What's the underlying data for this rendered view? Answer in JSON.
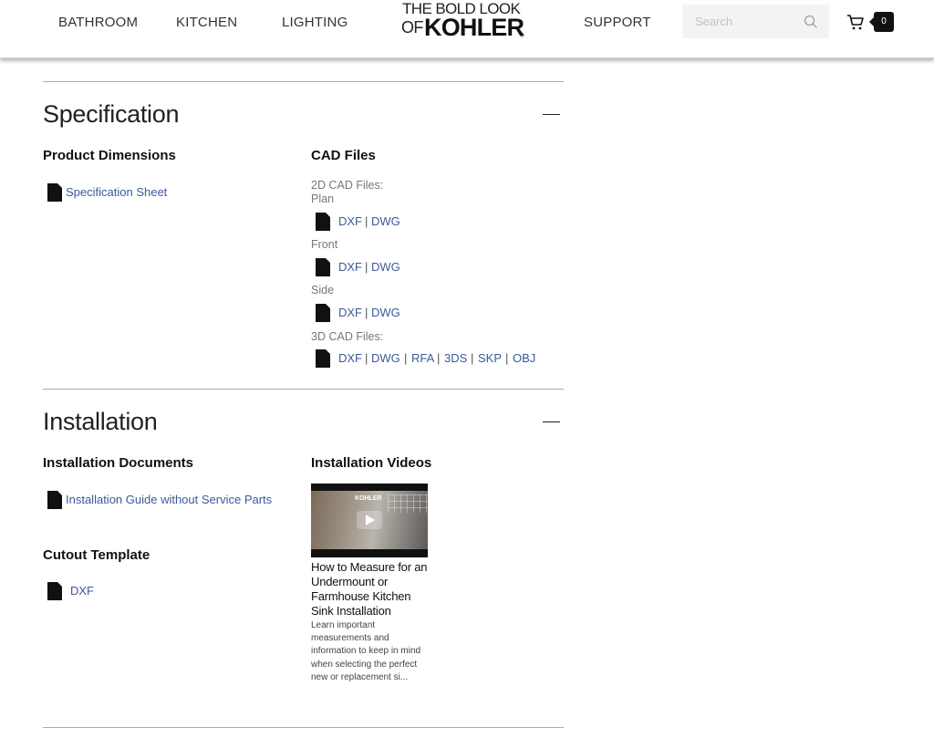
{
  "header": {
    "nav": [
      "BATHROOM",
      "KITCHEN",
      "LIGHTING",
      "SUPPORT"
    ],
    "logo": {
      "line1": "THE BOLD LOOK",
      "line2": "OF",
      "brand": "KOHLER",
      "mark": "®"
    },
    "search": {
      "placeholder": "Search"
    },
    "cart": {
      "count": "0"
    }
  },
  "specification": {
    "title": "Specification",
    "collapse_icon": "minus-icon",
    "product_dimensions": {
      "heading": "Product Dimensions",
      "links": [
        "Specification Sheet"
      ]
    },
    "cad_files": {
      "heading": "CAD Files",
      "label_2d": "2D CAD Files:",
      "groups": [
        {
          "label": "Plan",
          "formats": [
            "DXF",
            "DWG"
          ]
        },
        {
          "label": "Front",
          "formats": [
            "DXF",
            "DWG"
          ]
        },
        {
          "label": "Side",
          "formats": [
            "DXF",
            "DWG"
          ]
        }
      ],
      "label_3d": "3D CAD Files:",
      "formats_3d": [
        "DXF",
        "DWG",
        "RFA",
        "3DS",
        "SKP",
        "OBJ"
      ],
      "separator": "|"
    }
  },
  "installation": {
    "title": "Installation",
    "collapse_icon": "minus-icon",
    "documents": {
      "heading": "Installation Documents",
      "links": [
        "Installation Guide without Service Parts"
      ]
    },
    "cutout": {
      "heading": "Cutout Template",
      "links": [
        "DXF"
      ]
    },
    "videos": {
      "heading": "Installation Videos",
      "thumb_brand": "KOHLER",
      "items": [
        {
          "title": "How to Measure for an Undermount or Farmhouse Kitchen Sink Installation",
          "description": "Learn important measurements and information to keep in mind when selecting the perfect new or replacement si..."
        }
      ]
    }
  },
  "colors": {
    "link": "#3b5a9a",
    "text": "#222222",
    "rule": "#aaaaaa",
    "search_bg": "#f3f3f3"
  }
}
